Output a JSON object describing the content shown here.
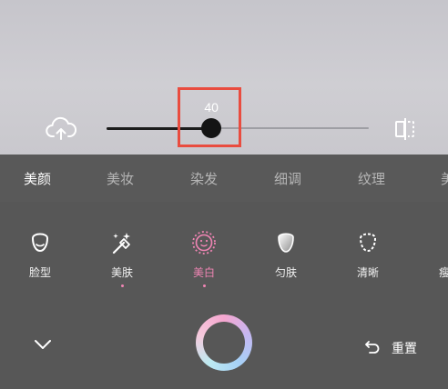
{
  "slider": {
    "value": "40",
    "level": 0.4
  },
  "tabs": [
    "美颜",
    "美妆",
    "染发",
    "细调",
    "纹理",
    "美"
  ],
  "tools": [
    "脸型",
    "美肤",
    "美白",
    "匀肤",
    "清晰",
    "瘦"
  ],
  "actions": {
    "reset_label": "重置"
  },
  "colors": {
    "accent_pink": "#f085b4",
    "highlight_red": "#e94c3f"
  },
  "icons": [
    "upload-icon",
    "compare-icon",
    "chevron-down-icon",
    "undo-icon"
  ]
}
